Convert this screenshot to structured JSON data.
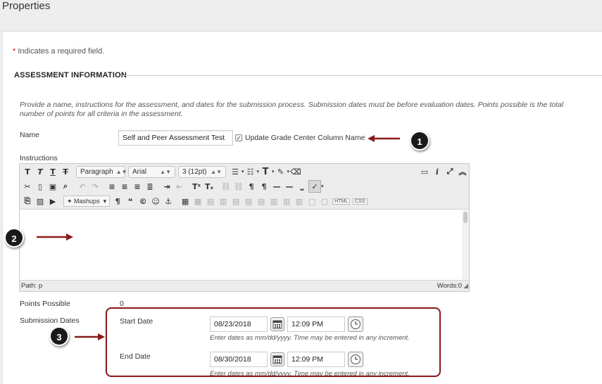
{
  "page": {
    "title": "Properties"
  },
  "required_note": {
    "star": "*",
    "text": " Indicates a required field."
  },
  "section": {
    "title": "ASSESSMENT INFORMATION",
    "intro": "Provide a name, instructions for the assessment, and dates for the submission process. Submission dates must be before evaluation dates. Points possible is the total number of points for all criteria in the assessment."
  },
  "name_field": {
    "label": "Name",
    "value": "Self and Peer Assessment Test",
    "checkbox_label": "Update Grade Center Column Name",
    "checkbox_checked": true
  },
  "instructions": {
    "label": "Instructions",
    "toolbar": {
      "paragraph": "Paragraph",
      "font": "Arial",
      "size": "3 (12pt)",
      "mashups": "Mashups",
      "html": "HTML",
      "css": "CSS"
    },
    "path": "Path: p",
    "words": "Words:0"
  },
  "points": {
    "label": "Points Possible",
    "value": "0"
  },
  "submission": {
    "label": "Submission Dates",
    "start_label": "Start Date",
    "start_date": "08/23/2018",
    "start_time": "12:09 PM",
    "end_label": "End Date",
    "end_date": "08/30/2018",
    "end_time": "12:09 PM",
    "hint": "Enter dates as mm/dd/yyyy. Time may be entered in any increment."
  },
  "callouts": [
    "1",
    "2",
    "3"
  ],
  "colors": {
    "annotation": "#8b1a1a",
    "required_star": "#cc0000",
    "callout_bg": "#1a1a1a"
  }
}
